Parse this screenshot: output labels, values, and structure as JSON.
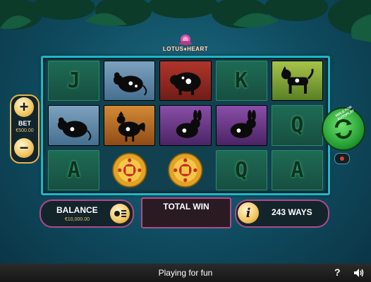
{
  "game": {
    "logo_text": "LOTUS♦HEART"
  },
  "reels": [
    [
      "J",
      "rat",
      "K",
      "rat-2",
      "A"
    ],
    [
      "rat",
      "rooster",
      "rabbit",
      "rabbit-2",
      "Q"
    ],
    [
      "A",
      "coin",
      "coin-2",
      "Q",
      "A"
    ]
  ],
  "symbols": {
    "row1": [
      {
        "kind": "card",
        "label": "J"
      },
      {
        "kind": "animal",
        "animal": "rat",
        "bg": "blue"
      },
      {
        "kind": "animal",
        "animal": "pig",
        "bg": "red"
      },
      {
        "kind": "card",
        "label": "K"
      },
      {
        "kind": "animal",
        "animal": "dog",
        "bg": "green"
      }
    ],
    "row2": [
      {
        "kind": "animal",
        "animal": "rat",
        "bg": "blue"
      },
      {
        "kind": "animal",
        "animal": "rooster",
        "bg": "orange"
      },
      {
        "kind": "animal",
        "animal": "rabbit",
        "bg": "purple"
      },
      {
        "kind": "animal",
        "animal": "rabbit",
        "bg": "purple"
      },
      {
        "kind": "card",
        "label": "Q"
      }
    ],
    "row3": [
      {
        "kind": "card",
        "label": "A"
      },
      {
        "kind": "coin",
        "animal": "lucky-coin"
      },
      {
        "kind": "coin",
        "animal": "lucky-coin"
      },
      {
        "kind": "card",
        "label": "Q"
      },
      {
        "kind": "card",
        "label": "A"
      }
    ]
  },
  "bet": {
    "label": "BET",
    "value": "€500.00",
    "plus": "+",
    "minus": "−"
  },
  "spin": {
    "autoplay_hint": "HOLD FOR AUTOPLAY"
  },
  "balance": {
    "label": "BALANCE",
    "value": "€10,000.00"
  },
  "total_win": {
    "label": "TOTAL WIN"
  },
  "ways": {
    "label": "243 WAYS",
    "info": "i"
  },
  "footer": {
    "status": "Playing for fun",
    "help": "?"
  },
  "colors": {
    "frame": "#1fb7c9",
    "accent_gold": "#e8b34a",
    "panel_border": "#b04a8b",
    "spin_green": "#239b31"
  }
}
